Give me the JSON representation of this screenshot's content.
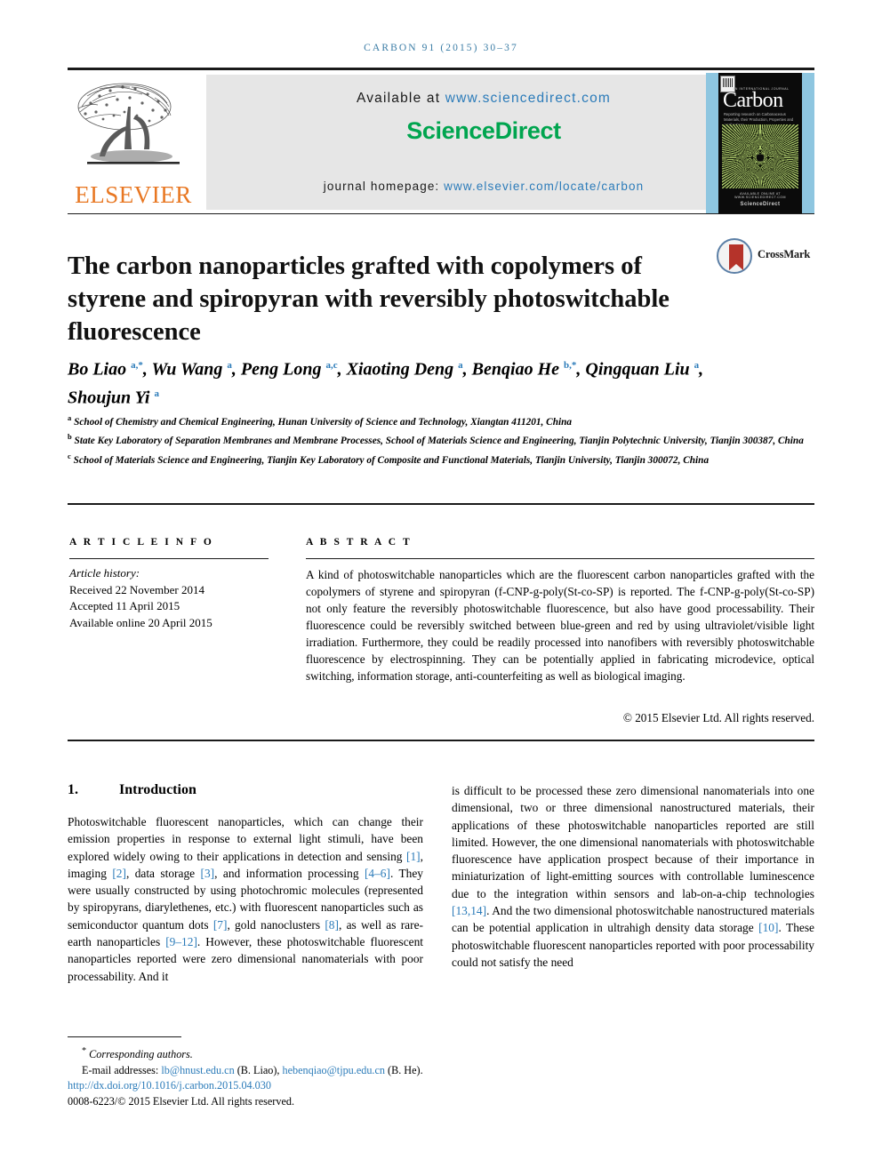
{
  "running_head": "CARBON 91 (2015) 30–37",
  "masthead": {
    "publisher_name": "ELSEVIER",
    "available_prefix": "Available at",
    "available_url": "www.sciencedirect.com",
    "sciencedirect_part1": "Science",
    "sciencedirect_part2": "Direct",
    "homepage_prefix": "journal homepage:",
    "homepage_url": "www.elsevier.com/locate/carbon",
    "cover": {
      "kicker": "AN INTERNATIONAL JOURNAL",
      "title": "Carbon",
      "subtitle": "Reporting research on Carbonaceous Materials, their Production, Properties and Applications",
      "footer_line1": "AVAILABLE ONLINE AT WWW.SCIENCEDIRECT.COM",
      "footer_line2": "ScienceDirect"
    }
  },
  "article": {
    "title": "The carbon nanoparticles grafted with copolymers of styrene and spiropyran with reversibly photoswitchable fluorescence",
    "crossmark_label": "CrossMark",
    "authors_line1": "Bo Liao <sup>a,*</sup>, Wu Wang <sup>a</sup>, Peng Long <sup>a,c</sup>, Xiaoting Deng <sup>a</sup>, Benqiao He <sup>b,*</sup>, Qingquan Liu <sup>a</sup>,",
    "authors_line2": "Shoujun Yi <sup>a</sup>",
    "affiliations": [
      "<sup>a</sup> School of Chemistry and Chemical Engineering, Hunan University of Science and Technology, Xiangtan 411201, China",
      "<sup>b</sup> State Key Laboratory of Separation Membranes and Membrane Processes, School of Materials Science and Engineering, Tianjin Polytechnic University, Tianjin 300387, China",
      "<sup>c</sup> School of Materials Science and Engineering, Tianjin Key Laboratory of Composite and Functional Materials, Tianjin University, Tianjin 300072, China"
    ]
  },
  "article_info": {
    "heading": "A R T I C L E   I N F O",
    "history_label": "Article history:",
    "received": "Received 22 November 2014",
    "accepted": "Accepted 11 April 2015",
    "available_online": "Available online 20 April 2015"
  },
  "abstract": {
    "heading": "A B S T R A C T",
    "text": "A kind of photoswitchable nanoparticles which are the fluorescent carbon nanoparticles grafted with the copolymers of styrene and spiropyran (f-CNP-g-poly(St-co-SP) is reported. The f-CNP-g-poly(St-co-SP) not only feature the reversibly photoswitchable fluorescence, but also have good processability. Their fluorescence could be reversibly switched between blue-green and red by using ultraviolet/visible light irradiation. Furthermore, they could be readily processed into nanofibers with reversibly photoswitchable fluorescence by electrospinning. They can be potentially applied in fabricating microdevice, optical switching, information storage, anti-counterfeiting as well as biological imaging.",
    "copyright": "© 2015 Elsevier Ltd. All rights reserved."
  },
  "body": {
    "section_number": "1.",
    "section_title": "Introduction",
    "left_column_html": "Photoswitchable fluorescent nanoparticles, which can change their emission properties in response to external light stimuli, have been explored widely owing to their applications in detection and sensing <span class=\"ref\">[1]</span>, imaging <span class=\"ref\">[2]</span>, data storage <span class=\"ref\">[3]</span>, and information processing <span class=\"ref\">[4–6]</span>. They were usually constructed by using photochromic molecules (represented by spiropyrans, diarylethenes, etc.) with fluorescent nanoparticles such as semiconductor quantum dots <span class=\"ref\">[7]</span>, gold nanoclusters <span class=\"ref\">[8]</span>, as well as rare-earth nanoparticles <span class=\"ref\">[9–12]</span>. However, these photoswitchable fluorescent nanoparticles reported were zero dimensional nanomaterials with poor processability. And it",
    "right_column_html": "is difficult to be processed these zero dimensional nanomaterials into one dimensional, two or three dimensional nanostructured materials, their applications of these photoswitchable nanoparticles reported are still limited. However, the one dimensional nanomaterials with photoswitchable fluorescence have application prospect because of their importance in miniaturization of light-emitting sources with controllable luminescence due to the integration within sensors and lab-on-a-chip technologies <span class=\"ref\">[13,14]</span>. And the two dimensional photoswitchable nanostructured materials can be potential application in ultrahigh density data storage <span class=\"ref\">[10]</span>. These photoswitchable fluorescent nanoparticles reported with poor processability could not satisfy the need"
  },
  "footer": {
    "corresponding_html": "<sup>*</sup> Corresponding authors.",
    "emails_html": "E-mail addresses: <span class=\"link\">lb@hnust.edu.cn</span> (B. Liao), <span class=\"link\">hebenqiao@tjpu.edu.cn</span> (B. He).",
    "doi": "http://dx.doi.org/10.1016/j.carbon.2015.04.030",
    "issn_line": "0008-6223/© 2015 Elsevier Ltd. All rights reserved."
  },
  "colors": {
    "elsevier_orange": "#E87722",
    "sciencedirect_green": "#00a54f",
    "link_blue": "#2b7bb9",
    "running_head_blue": "#3a7ca5",
    "crossmark_red": "#b5332a",
    "cover_blue": "#8ec6e0"
  }
}
